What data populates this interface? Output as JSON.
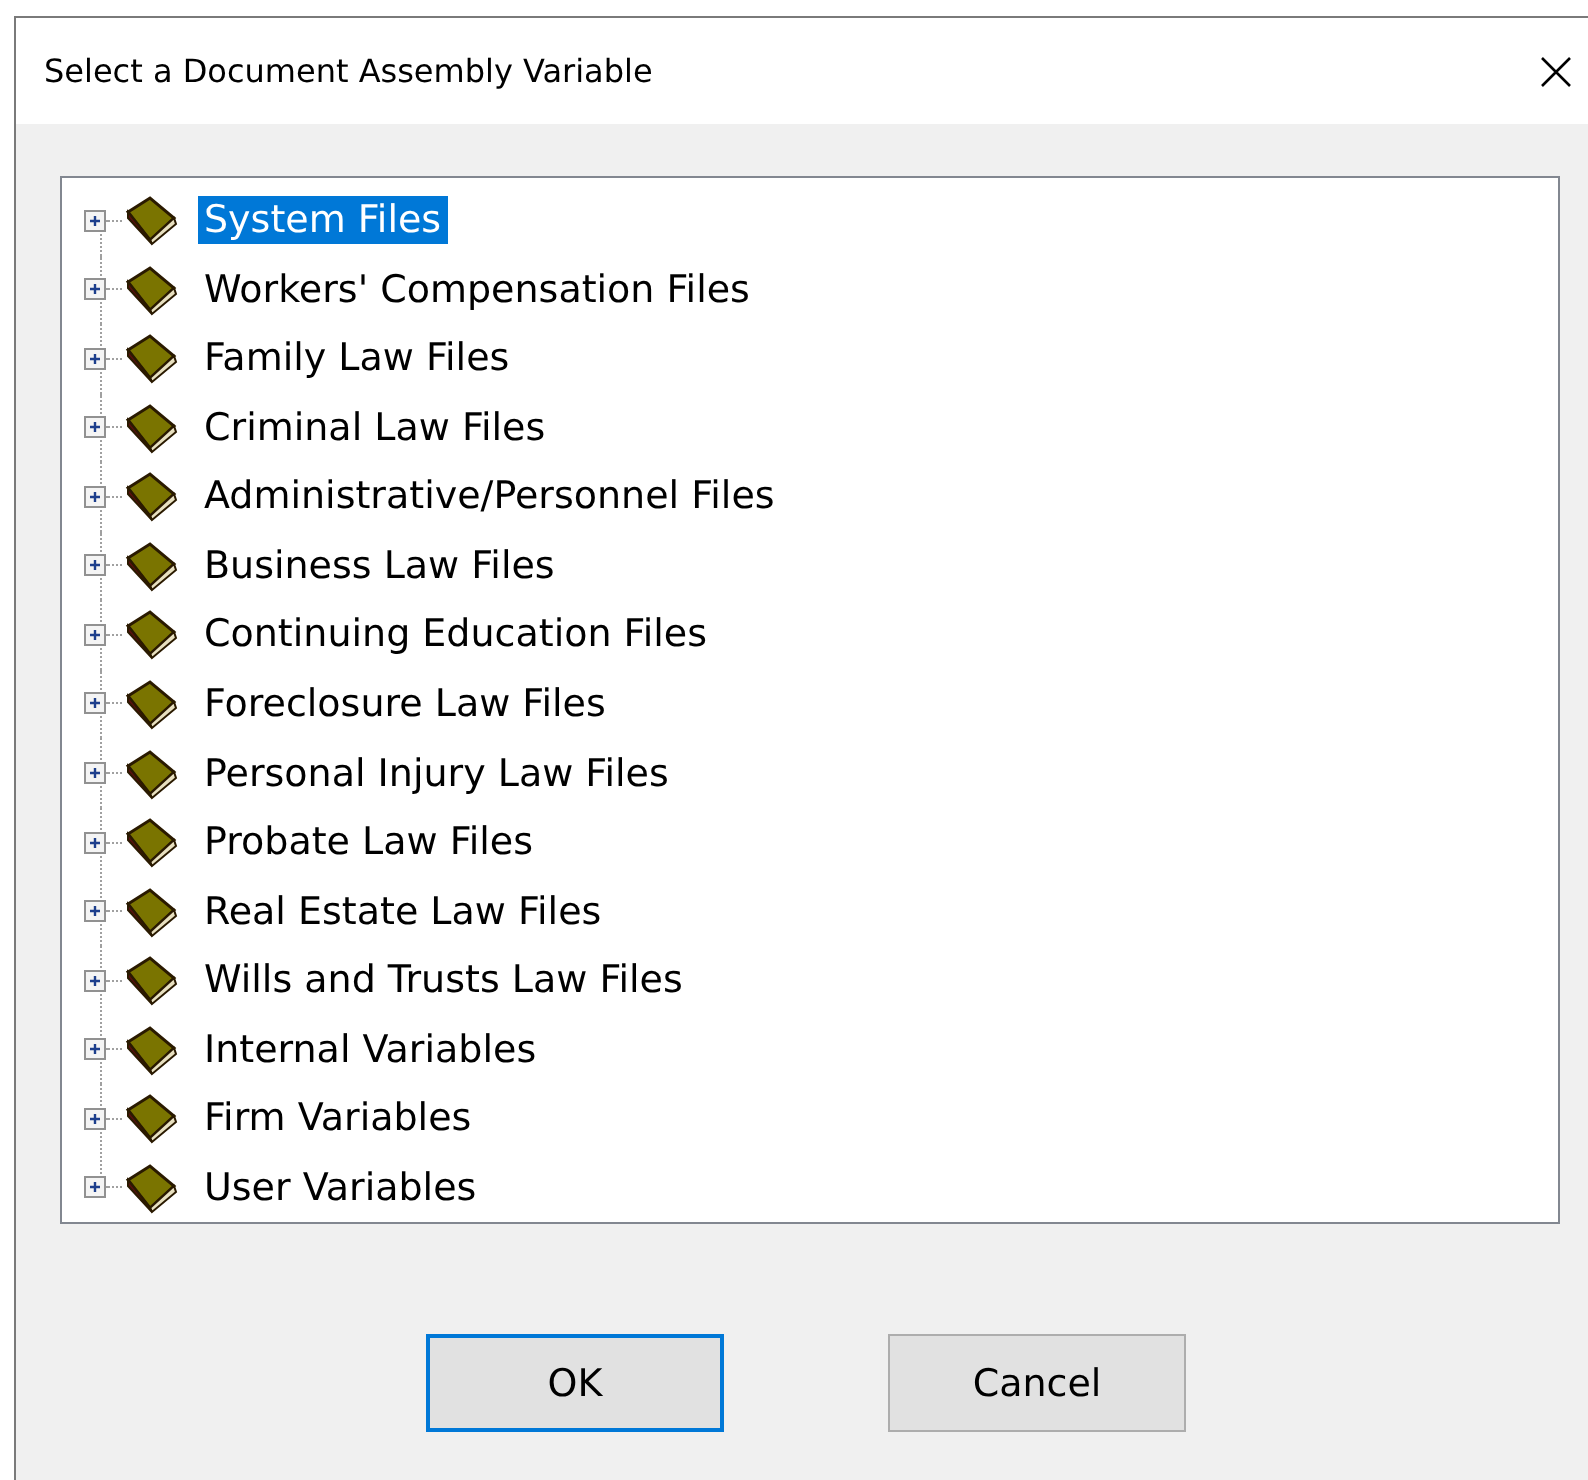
{
  "window": {
    "title": "Select a Document Assembly Variable"
  },
  "tree": {
    "items": [
      {
        "label": "System Files",
        "selected": true,
        "expanded": false
      },
      {
        "label": "Workers' Compensation Files",
        "selected": false,
        "expanded": false
      },
      {
        "label": "Family Law Files",
        "selected": false,
        "expanded": false
      },
      {
        "label": "Criminal Law Files",
        "selected": false,
        "expanded": false
      },
      {
        "label": "Administrative/Personnel Files",
        "selected": false,
        "expanded": false
      },
      {
        "label": "Business Law Files",
        "selected": false,
        "expanded": false
      },
      {
        "label": "Continuing Education Files",
        "selected": false,
        "expanded": false
      },
      {
        "label": "Foreclosure Law Files",
        "selected": false,
        "expanded": false
      },
      {
        "label": "Personal Injury Law Files",
        "selected": false,
        "expanded": false
      },
      {
        "label": "Probate Law Files",
        "selected": false,
        "expanded": false
      },
      {
        "label": "Real Estate Law Files",
        "selected": false,
        "expanded": false
      },
      {
        "label": "Wills and Trusts Law Files",
        "selected": false,
        "expanded": false
      },
      {
        "label": "Internal Variables",
        "selected": false,
        "expanded": false
      },
      {
        "label": "Firm Variables",
        "selected": false,
        "expanded": false
      },
      {
        "label": "User Variables",
        "selected": false,
        "expanded": false
      }
    ]
  },
  "buttons": [
    {
      "label": "OK",
      "default": true
    },
    {
      "label": "Cancel",
      "default": false
    }
  ]
}
